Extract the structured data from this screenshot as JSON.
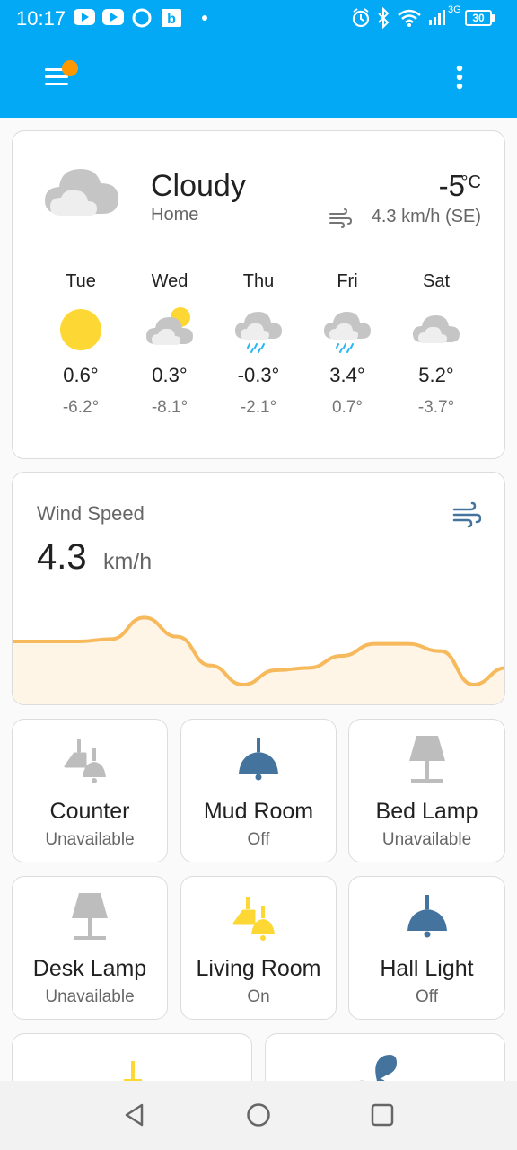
{
  "status_bar": {
    "time": "10:17",
    "network": "3G",
    "battery": "30"
  },
  "app_bar": {
    "menu_icon": "menu-icon",
    "notification_color": "#ff9800",
    "more_icon": "more-vert-icon",
    "color": "#03a9f4"
  },
  "weather": {
    "condition": "Cloudy",
    "location": "Home",
    "temperature": "-5",
    "unit": "°C",
    "wind": "4.3 km/h (SE)",
    "forecast": [
      {
        "day": "Tue",
        "icon": "sunny-icon",
        "high": "0.6°",
        "low": "-6.2°"
      },
      {
        "day": "Wed",
        "icon": "partly-cloudy-icon",
        "high": "0.3°",
        "low": "-8.1°"
      },
      {
        "day": "Thu",
        "icon": "snowy-rainy-icon",
        "high": "-0.3°",
        "low": "-2.1°"
      },
      {
        "day": "Fri",
        "icon": "snowy-rainy-icon",
        "high": "3.4°",
        "low": "0.7°"
      },
      {
        "day": "Sat",
        "icon": "cloudy-icon",
        "high": "5.2°",
        "low": "-3.7°"
      }
    ]
  },
  "wind_speed": {
    "title": "Wind Speed",
    "value": "4.3",
    "unit": "km/h",
    "graph_color": "#f6b95c",
    "graph_fill": "#fef5e7",
    "trend": [
      4.2,
      4.2,
      4.2,
      4.3,
      5.2,
      4.4,
      3.2,
      2.4,
      3.0,
      3.1,
      3.6,
      4.1,
      4.1,
      3.8,
      2.4,
      3.1
    ]
  },
  "tiles": [
    {
      "name": "Counter",
      "state": "Unavailable",
      "icon": "ceiling-lights-icon",
      "color": "#bdbdbd"
    },
    {
      "name": "Mud Room",
      "state": "Off",
      "icon": "ceiling-light-icon",
      "color": "#44739e"
    },
    {
      "name": "Bed Lamp",
      "state": "Unavailable",
      "icon": "lamp-icon",
      "color": "#bdbdbd"
    },
    {
      "name": "Desk Lamp",
      "state": "Unavailable",
      "icon": "lamp-icon",
      "color": "#bdbdbd"
    },
    {
      "name": "Living Room",
      "state": "On",
      "icon": "ceiling-lights-icon",
      "color": "#fdd835"
    },
    {
      "name": "Hall Light",
      "state": "Off",
      "icon": "ceiling-light-icon",
      "color": "#44739e"
    }
  ],
  "partial_tiles": [
    {
      "icon": "floor-lamp-icon",
      "color": "#fdd835"
    },
    {
      "icon": "fan-icon",
      "color": "#44739e"
    }
  ],
  "nav": {
    "back_icon": "back-icon",
    "home_icon": "home-icon",
    "recents_icon": "recents-icon"
  }
}
